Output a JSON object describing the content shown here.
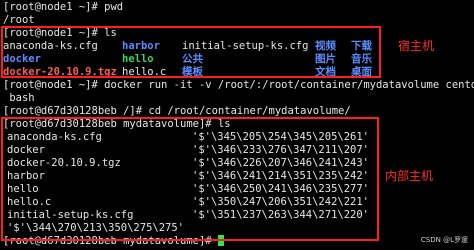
{
  "terminal": {
    "prompt_host": "[root@node1 ~]#",
    "cmd_pwd": " pwd",
    "out_pwd": "/root",
    "cmd_ls": " ls",
    "ls_row1": [
      "anaconda-ks.cfg",
      "harbor",
      "initial-setup-ks.cfg",
      "视频",
      "下载"
    ],
    "ls_row2": [
      "docker",
      "hello",
      "公共",
      "图片",
      "音乐"
    ],
    "ls_row3": [
      "docker-20.10.9.tgz",
      "hello.c",
      "模板",
      "文档",
      "桌面"
    ],
    "cmd_docker": " docker run -it -v /root/:/root/container/mydatavolume centos",
    "cmd_docker_cont": " bash",
    "prompt_container": "[root@d67d30128beb /]#",
    "cmd_cd": " cd /root/container/mydatavolume/",
    "prompt_container2": "[root@d67d30128beb mydatavolume]#",
    "cmd_ls2": " ls",
    "c_rows": [
      {
        "left": "anaconda-ks.cfg",
        "right": "'$'\\345\\205\\254\\345\\205\\261'"
      },
      {
        "left": "docker",
        "right": "'$'\\346\\233\\276\\347\\211\\207'"
      },
      {
        "left": "docker-20.10.9.tgz",
        "right": "'$'\\346\\226\\207\\346\\241\\243'"
      },
      {
        "left": "harbor",
        "right": "'$'\\346\\241\\214\\351\\235\\242'"
      },
      {
        "left": "hello",
        "right": "'$'\\346\\250\\241\\346\\235\\277'"
      },
      {
        "left": "hello.c",
        "right": "'$'\\350\\247\\206\\351\\242\\221'"
      },
      {
        "left": "initial-setup-ks.cfg",
        "right": "'$'\\351\\237\\263\\344\\271\\220'"
      }
    ],
    "c_last": "'$'\\344\\270\\213\\350\\275\\275'",
    "prompt_final": "[root@d67d30128beb mydatavolume]#"
  },
  "annotations": {
    "host_label": "宿主机",
    "container_label": "内部主机"
  },
  "watermark": "CSDN @L罗邃",
  "colors": {
    "box": "#ff1e1e",
    "dir": "#5c8cff",
    "exec": "#3fd35a",
    "archive": "#ff5a5a"
  }
}
